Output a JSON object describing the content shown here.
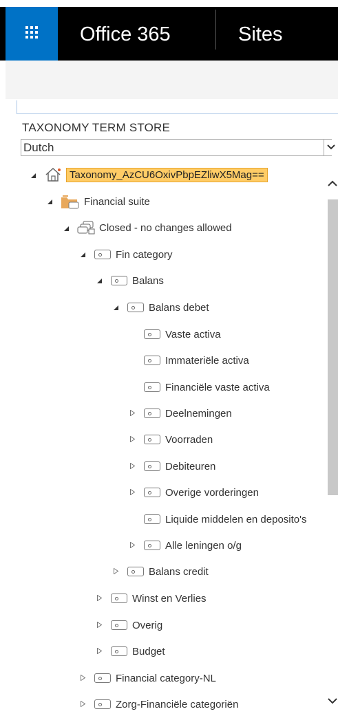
{
  "header": {
    "brand": "Office 365",
    "section": "Sites",
    "accent": "#0072c6"
  },
  "panel": {
    "title": "TAXONOMY TERM STORE",
    "language": "Dutch"
  },
  "tree": {
    "root": "Taxonomy_AzCU6OxivPbpEZliwX5Mag==",
    "group": "Financial suite",
    "termset": "Closed - no changes allowed",
    "fin_category": "Fin category",
    "balans": "Balans",
    "balans_debet": "Balans debet",
    "vaste_activa": "Vaste activa",
    "immateriele_activa": "Immateriële activa",
    "financiele_vaste_activa": "Financiële vaste activa",
    "deelnemingen": "Deelnemingen",
    "voorraden": "Voorraden",
    "debiteuren": "Debiteuren",
    "overige_vorderingen": "Overige vorderingen",
    "liquide_middelen": "Liquide middelen en deposito's",
    "alle_leningen": "Alle leningen o/g",
    "balans_credit": "Balans credit",
    "winst_en_verlies": "Winst en Verlies",
    "overig": "Overig",
    "budget": "Budget",
    "financial_category_nl": "Financial category-NL",
    "zorg_financiele": "Zorg-Financiële categoriën"
  }
}
